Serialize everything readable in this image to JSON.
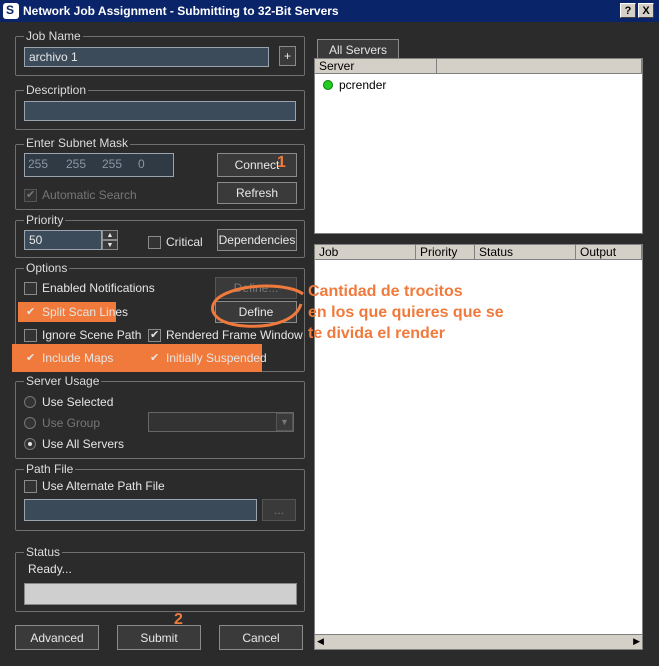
{
  "window": {
    "title": "Network Job Assignment - Submitting to 32-Bit Servers",
    "help_btn": "?",
    "close_btn": "X"
  },
  "job_name": {
    "label": "Job Name",
    "value": "archivo 1",
    "plus": "+"
  },
  "description": {
    "label": "Description",
    "value": ""
  },
  "subnet": {
    "label": "Enter Subnet Mask",
    "octets": [
      "255",
      "255",
      "255",
      "0"
    ],
    "connect": "Connect",
    "refresh": "Refresh",
    "auto_search": "Automatic Search"
  },
  "priority": {
    "label": "Priority",
    "value": "50",
    "critical": "Critical",
    "dependencies": "Dependencies"
  },
  "options": {
    "label": "Options",
    "enabled_notifications": "Enabled Notifications",
    "define1": "Define...",
    "split_scan_lines": "Split Scan Lines",
    "define2": "Define",
    "ignore_scene_path": "Ignore Scene Path",
    "rendered_frame_window": "Rendered Frame Window",
    "include_maps": "Include Maps",
    "initially_suspended": "Initially Suspended"
  },
  "server_usage": {
    "label": "Server Usage",
    "use_selected": "Use Selected",
    "use_group": "Use Group",
    "use_all": "Use All Servers"
  },
  "path_file": {
    "label": "Path File",
    "use_alternate": "Use Alternate Path File",
    "browse": "..."
  },
  "status": {
    "label": "Status",
    "text": "Ready..."
  },
  "buttons": {
    "advanced": "Advanced",
    "submit": "Submit",
    "cancel": "Cancel"
  },
  "servers": {
    "tab": "All Servers",
    "column": "Server",
    "rows": [
      {
        "name": "pcrender",
        "status_color": "#22cc22"
      }
    ]
  },
  "jobs": {
    "columns": [
      "Job",
      "Priority",
      "Status",
      "Output"
    ]
  },
  "annotations": {
    "one": "1",
    "two": "2",
    "note_line1": "Cantidad de trocitos",
    "note_line2": "en los que quieres que se",
    "note_line3": "te divida el render"
  },
  "colors": {
    "accent": "#f07a3c",
    "title_bar": "#0a246a"
  }
}
